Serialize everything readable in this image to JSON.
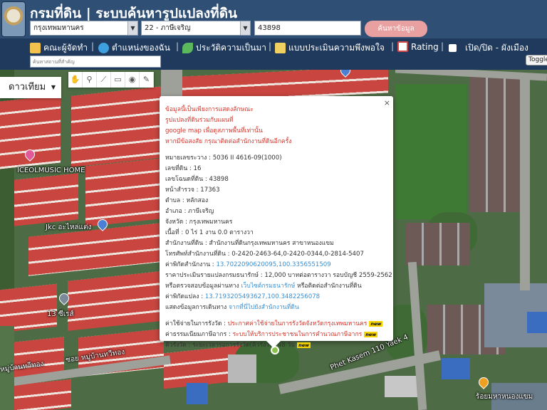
{
  "header": {
    "site_title": "กรมที่ดิน | ระบบค้นหารูปแปลงที่ดิน",
    "province": "กรุงเทพมหานคร",
    "district": "22 - ภาษีเจริญ",
    "parcel_number": "43898",
    "search_button": "ค้นหาข้อมูล"
  },
  "nav": {
    "items": [
      {
        "label": "คณะผู้จัดทำ",
        "icon": "team-icon",
        "color": "#f2c14e"
      },
      {
        "label": "ตำแหน่งของฉัน",
        "icon": "globe-icon",
        "color": "#3fa0e0"
      },
      {
        "label": "ประวัติความเป็นมา",
        "icon": "sprout-icon",
        "color": "#5cb85c"
      },
      {
        "label": "แบบประเมินความพึงพอใจ",
        "icon": "survey-icon",
        "color": "#f0d060"
      },
      {
        "label": "Rating",
        "icon": "chart-icon",
        "color": "#d84a4a"
      },
      {
        "label": "เปิด/ปิด - ผังเมือง",
        "icon": "checkbox-icon",
        "color": "#ffffff"
      }
    ],
    "address_placeholder": "ค้นหาสถานที่สำคัญ",
    "toggle_label": "Toggle"
  },
  "map": {
    "map_type": "ดาวเทียม",
    "tools": [
      "✋",
      "⚲",
      "⟋",
      "▭",
      "◉",
      "✎"
    ],
    "labels": {
      "music_home": "ICEOLMUSIC HOME",
      "shop": "Jkc อะไหล่แต่ง",
      "poi_13": "13 ซีเรส์",
      "village_a": "หมู่บ้านทวีทอง",
      "village_b": "ซอย หมู่บ้านทวีทอง",
      "road": "Phet Kasem 110 Yaek 4",
      "temple": "ร้อยมหาหนองแขม"
    }
  },
  "popup": {
    "notice": [
      "ข้อมูลนี้เป็นเพียงการแสดงลักษณะ",
      "รูปแปลงที่ดินร่วมกับแผนที่",
      "google map เพื่อดูสภาพพื้นที่เท่านั้น",
      "หากมีข้อสงสัย กรุณาติดต่อสำนักงานที่ดินอีกครั้ง"
    ],
    "details": [
      "หมายเลขระวาง : 5036 II 4616-09(1000)",
      "เลขที่ดิน : 16",
      "เลขโฉนดที่ดิน : 43898",
      "หน้าสำรวจ : 17363",
      "ตำบล : หลักสอง",
      "อำเภอ : ภาษีเจริญ",
      "จังหวัด : กรุงเทพมหานคร",
      "เนื้อที่ : 0 ไร่ 1 งาน 0.0 ตารางวา",
      "สำนักงานที่ดิน : สำนักงานที่ดินกรุงเทพมหานคร สาขาหนองแขม",
      "โทรศัพท์สำนักงานที่ดิน : 0-2420-2463-64,0-2420-0344,0-2814-5407"
    ],
    "office_coord_label": "ค่าพิกัดสำนักงาน : ",
    "office_coord": "13.7022090620095,100.3356551509",
    "price_text": "ราคาประเมินรายแปลงกรมธนารักษ์ : 12,000 บาทต่อตารางวา รอบบัญชี 2559-2562",
    "check_prefix": "หรือตรวจสอบข้อมูลผ่านทาง ",
    "check_link": "เว็บไซต์กรมธนารักษ์",
    "check_suffix": " หรือติดต่อสำนักงานที่ดิน",
    "parcel_coord_label": "ค่าพิกัดแปลง : ",
    "parcel_coord": "13.7193205493627,100.3482256078",
    "directions_prefix": "แสดงข้อมูลการเดินทาง ",
    "directions_link": "จากที่นี่ไปยังสำนักงานที่ดิน",
    "fee_label": "ค่าใช้จ่ายในการรังวัด : ",
    "fee_link": "ประกาศค่าใช้จ่ายในการรังวัดจังหวัดกรุงเทพมหานคร",
    "service_label": "ค่าธรรมเนียมภาษีอากร : ",
    "service_link": "ระบบให้บริการประชาชนในการคำนวณภาษีอากร",
    "queue_text": "คิวรังวัด : ระยะเวลารอการรังวัด(คิวรังวัด) 48 วัน",
    "badge": "new",
    "close": "×"
  }
}
